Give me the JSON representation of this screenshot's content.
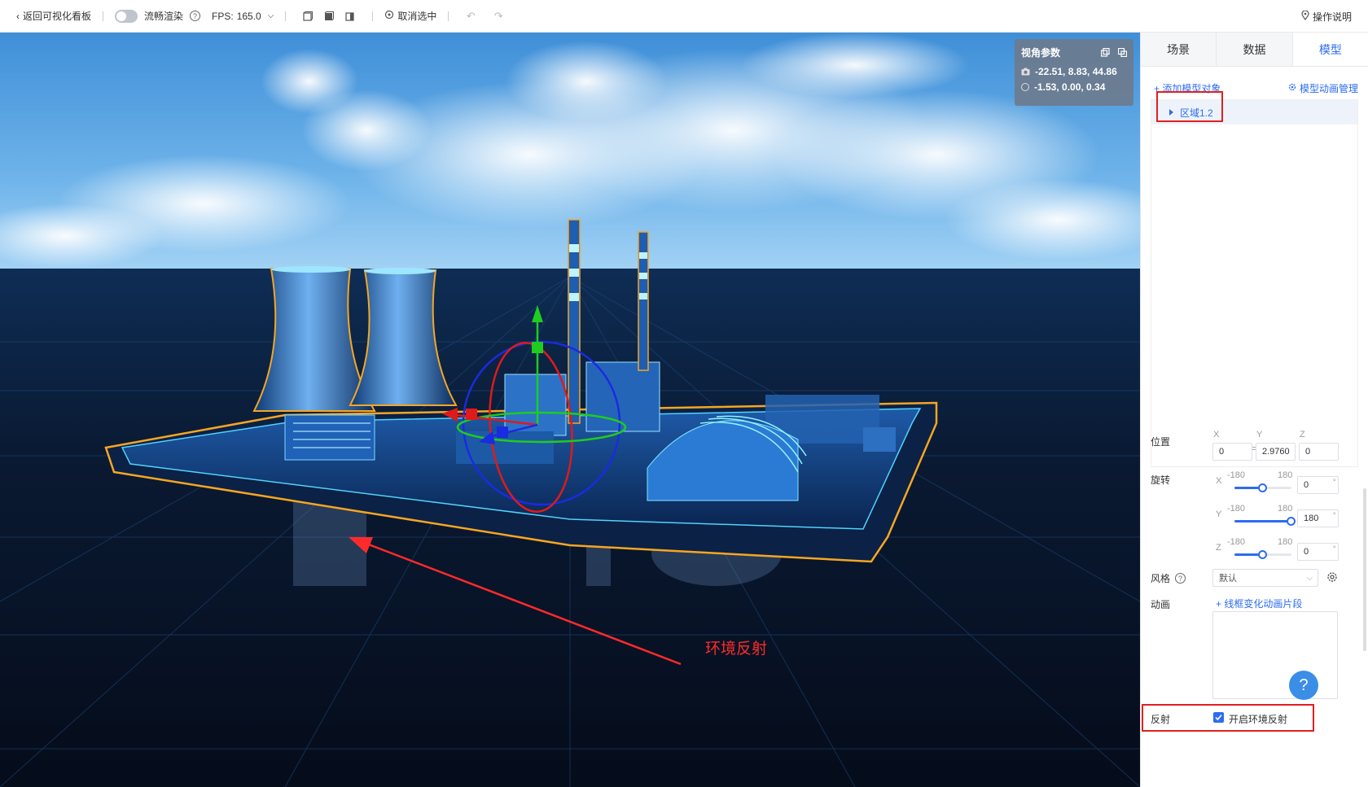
{
  "toolbar": {
    "back_label": "返回可视化看板",
    "smooth_label": "流畅渲染",
    "fps_label": "FPS:",
    "fps_value": "165.0",
    "deselect_label": "取消选中",
    "help_label": "操作说明"
  },
  "camera": {
    "title": "视角参数",
    "position": "-22.51, 8.83, 44.86",
    "target": "-1.53, 0.00, 0.34"
  },
  "annotation": {
    "label": "环境反射"
  },
  "panel": {
    "tabs": [
      {
        "label": "场景"
      },
      {
        "label": "数据"
      },
      {
        "label": "模型"
      }
    ],
    "active_tab": "模型",
    "add_model_label": "+ 添加模型对象",
    "anim_manage_label": "模型动画管理",
    "tree": [
      {
        "label": "区域1.2"
      }
    ],
    "position": {
      "label": "位置",
      "x_label": "X",
      "y_label": "Y",
      "z_label": "Z",
      "x": "0",
      "y": "2.9760",
      "z": "0"
    },
    "rotation": {
      "label": "旋转",
      "min": "-180",
      "max": "180",
      "x_label": "X",
      "y_label": "Y",
      "z_label": "Z",
      "x": "0",
      "y": "180",
      "z": "0",
      "deg_symbol": "°"
    },
    "rotation_levels": {
      "x": 0.5,
      "y": 1.0,
      "z": 0.5
    },
    "style": {
      "label": "风格",
      "value": "默认"
    },
    "animation": {
      "label": "动画",
      "add_label": "+ 线框变化动画片段"
    },
    "reflection": {
      "label": "反射",
      "checkbox_label": "开启环境反射",
      "checked": true
    }
  },
  "colors": {
    "accent": "#2d6cf0",
    "highlight": "#e0201e",
    "model_outline": "#f5a623"
  }
}
